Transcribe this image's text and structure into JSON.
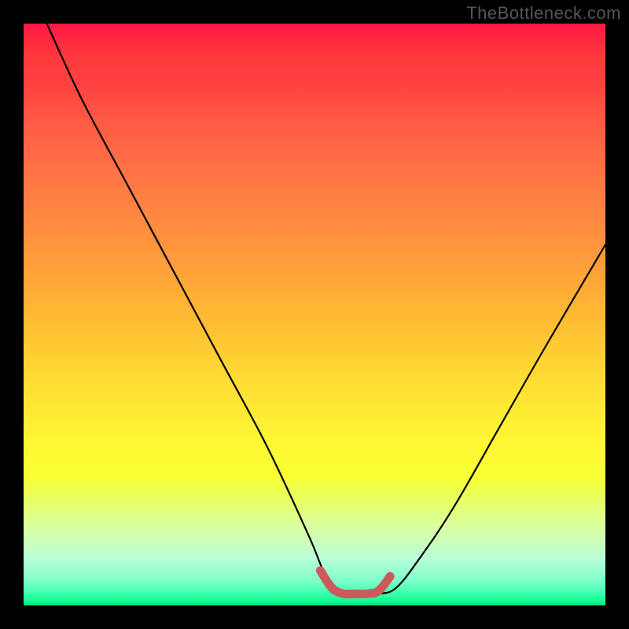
{
  "watermark": "TheBottleneck.com",
  "chart_data": {
    "type": "line",
    "title": "",
    "xlabel": "",
    "ylabel": "",
    "xlim": [
      0,
      100
    ],
    "ylim": [
      0,
      100
    ],
    "grid": false,
    "legend": false,
    "series": [
      {
        "name": "bottleneck-curve",
        "x": [
          4,
          10,
          18,
          26,
          34,
          42,
          49,
          52,
          55,
          58,
          61,
          64,
          68,
          74,
          82,
          90,
          100
        ],
        "values": [
          100,
          87,
          72,
          57,
          42,
          27,
          12,
          5,
          2,
          2,
          2,
          3,
          8,
          17,
          31,
          45,
          62
        ]
      }
    ],
    "highlight_segment": {
      "name": "valley-highlight",
      "x": [
        51,
        53,
        55,
        57,
        59,
        61,
        63
      ],
      "values": [
        6,
        3,
        2,
        2,
        2,
        2.5,
        5
      ],
      "color": "#cc5a5a"
    },
    "background_gradient_stops": [
      {
        "pos": 0,
        "color": "#ff1744"
      },
      {
        "pos": 50,
        "color": "#ffd233"
      },
      {
        "pos": 80,
        "color": "#f7ff33"
      },
      {
        "pos": 100,
        "color": "#00e676"
      }
    ]
  }
}
